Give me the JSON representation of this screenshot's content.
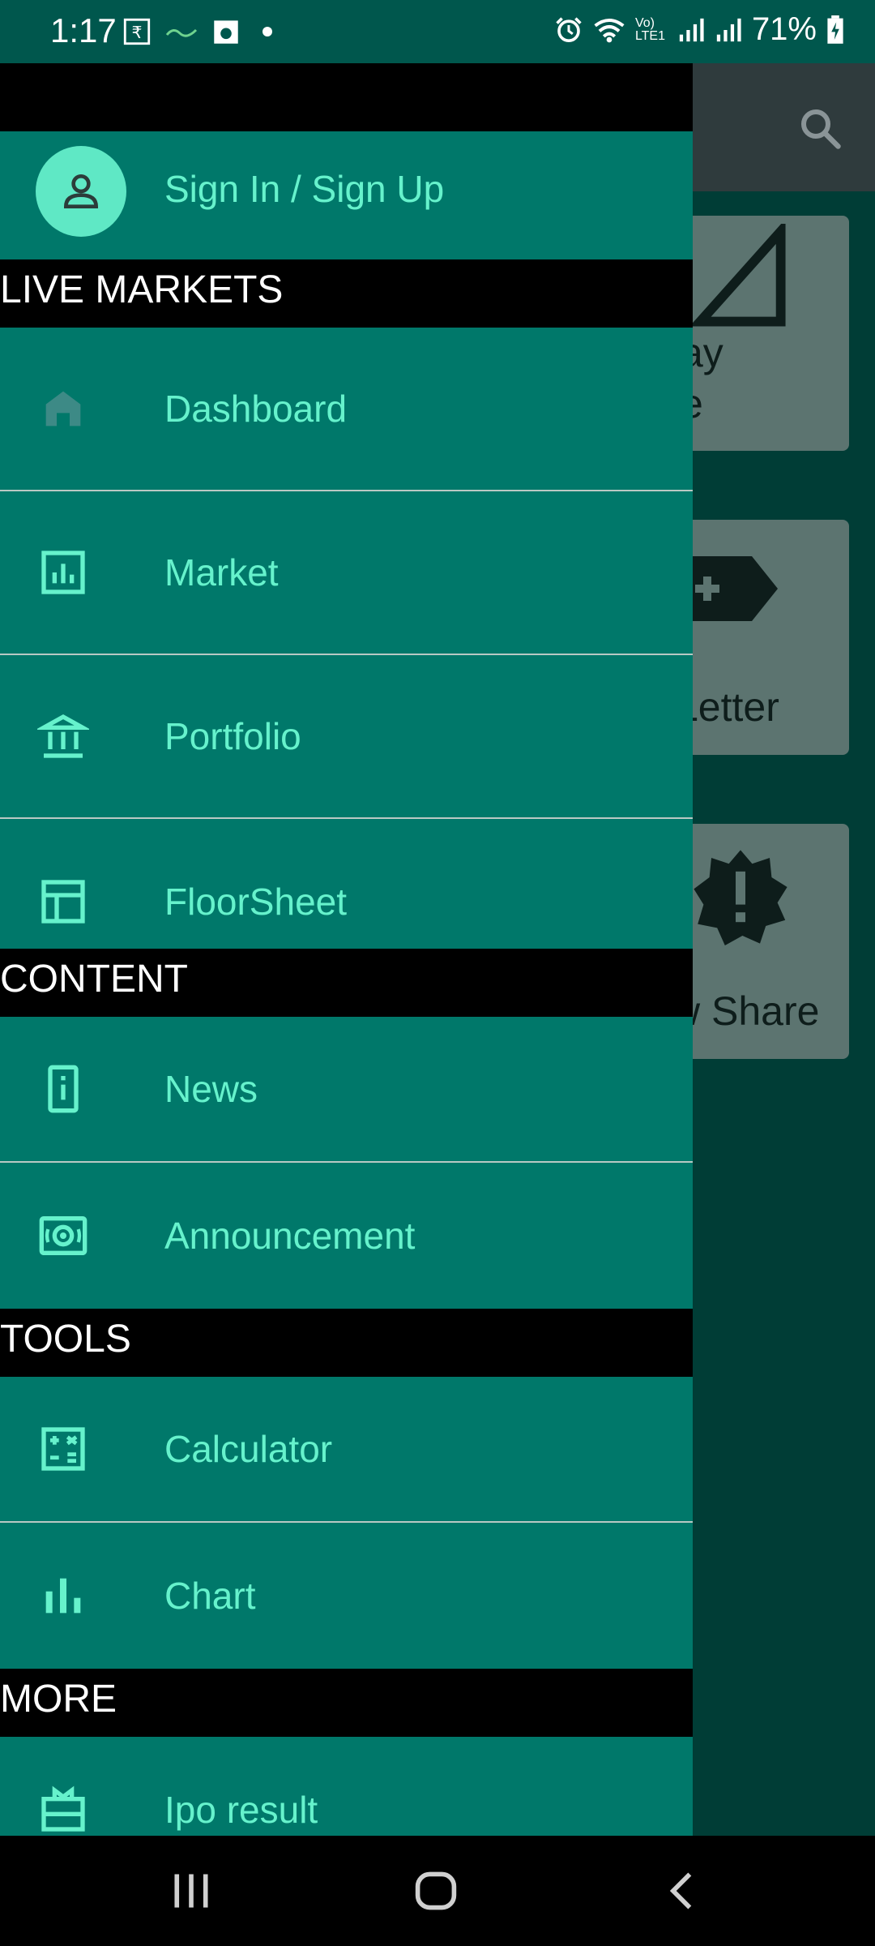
{
  "status_bar": {
    "time": "1:17",
    "battery": "71%",
    "network_label": "Vo) LTE1"
  },
  "background": {
    "cards": [
      {
        "caption": "ay\ne",
        "icon": "triangle-icon"
      },
      {
        "caption": "Letter",
        "icon": "label-plus-icon"
      },
      {
        "caption": "w Share",
        "icon": "alert-badge-icon"
      }
    ]
  },
  "drawer": {
    "sign_in": "Sign In / Sign Up",
    "sections": {
      "live_markets": "LIVE MARKETS",
      "content": "CONTENT",
      "tools": "TOOLS",
      "more": "MORE"
    },
    "items": {
      "dashboard": "Dashboard",
      "market": "Market",
      "portfolio": "Portfolio",
      "floorsheet": "FloorSheet",
      "news": "News",
      "announcement": "Announcement",
      "calculator": "Calculator",
      "chart": "Chart",
      "ipo_result": "Ipo result"
    }
  },
  "colors": {
    "drawer_bg": "#00786a",
    "accent_text": "#66f2cc",
    "section_bg": "#000000",
    "avatar_bg": "#5fe8c5"
  }
}
